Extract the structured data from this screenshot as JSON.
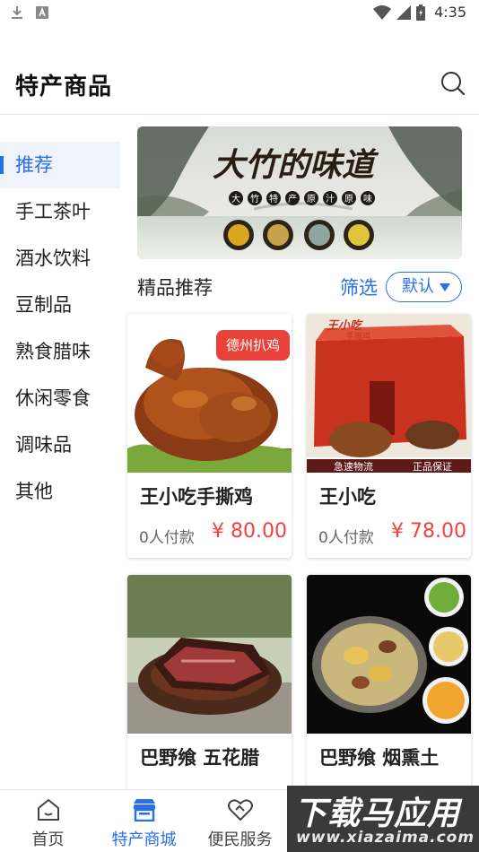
{
  "status_bar": {
    "time": "4:35",
    "left_icons": [
      "download-icon",
      "notification-a-icon"
    ],
    "right_icons": [
      "wifi-icon",
      "signal-icon",
      "battery-icon"
    ]
  },
  "header": {
    "title": "特产商品",
    "search_icon": "search-icon"
  },
  "sidebar": {
    "items": [
      {
        "label": "推荐",
        "active": true
      },
      {
        "label": "手工茶叶",
        "active": false
      },
      {
        "label": "酒水饮料",
        "active": false
      },
      {
        "label": "豆制品",
        "active": false
      },
      {
        "label": "熟食腊味",
        "active": false
      },
      {
        "label": "休闲零食",
        "active": false
      },
      {
        "label": "调味品",
        "active": false
      },
      {
        "label": "其他",
        "active": false
      }
    ]
  },
  "banner": {
    "headline": "大竹的味道",
    "tagline_chars": [
      "大",
      "竹",
      "特",
      "产",
      "原",
      "汁",
      "原",
      "味"
    ]
  },
  "section": {
    "title": "精品推荐",
    "filter_label": "筛选",
    "sort_value": "默认"
  },
  "products": [
    {
      "name": "王小吃手撕鸡",
      "buyers": "0人付款",
      "price": "¥ 80.00",
      "tag": "德州扒鸡"
    },
    {
      "name": "王小吃",
      "buyers": "0人付款",
      "price": "¥ 78.00",
      "box_brand": "王小吃",
      "box_sub": "手撕鸡",
      "strip_left": "急速物流",
      "strip_right": "正品保证"
    },
    {
      "name": "巴野飨 五花腊",
      "buyers": "",
      "price": ""
    },
    {
      "name": "巴野飨 烟熏土",
      "buyers": "",
      "price": ""
    }
  ],
  "bottom_nav": {
    "items": [
      {
        "label": "首页",
        "icon": "home-icon",
        "active": false
      },
      {
        "label": "特产商城",
        "icon": "shop-icon",
        "active": true
      },
      {
        "label": "便民服务",
        "icon": "heart-hands-icon",
        "active": false
      }
    ]
  },
  "watermark": {
    "main": "下载马应用",
    "sub": "www.xiazaima.com"
  },
  "colors": {
    "accent": "#2a6ee8",
    "price": "#f0433f",
    "tag_bg": "#e8423a"
  }
}
